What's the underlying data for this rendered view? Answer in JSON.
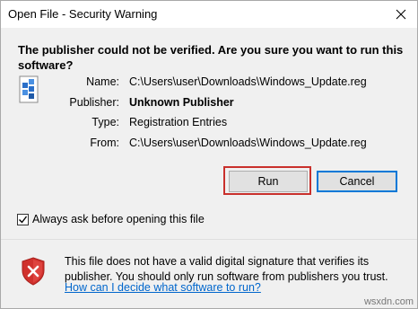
{
  "window": {
    "title": "Open File - Security Warning"
  },
  "warning": {
    "headline": "The publisher could not be verified.  Are you sure you want to run this software?"
  },
  "details": [
    {
      "label": "Name:",
      "value": "C:\\Users\\user\\Downloads\\Windows_Update.reg",
      "bold": false
    },
    {
      "label": "Publisher:",
      "value": "Unknown Publisher",
      "bold": true
    },
    {
      "label": "Type:",
      "value": "Registration Entries",
      "bold": false
    },
    {
      "label": "From:",
      "value": "C:\\Users\\user\\Downloads\\Windows_Update.reg",
      "bold": false
    }
  ],
  "buttons": {
    "run": "Run",
    "cancel": "Cancel"
  },
  "highlight_color": "#c9302c",
  "checkbox": {
    "label": "Always ask before opening this file",
    "checked": true
  },
  "footer": {
    "message": "This file does not have a valid digital signature that verifies its publisher.  You should only run software from publishers you trust.",
    "link": "How can I decide what software to run?"
  },
  "icons": {
    "file": "registry-file-icon",
    "shield": "security-shield-icon",
    "close": "close-icon"
  },
  "watermark": "wsxdn.com"
}
